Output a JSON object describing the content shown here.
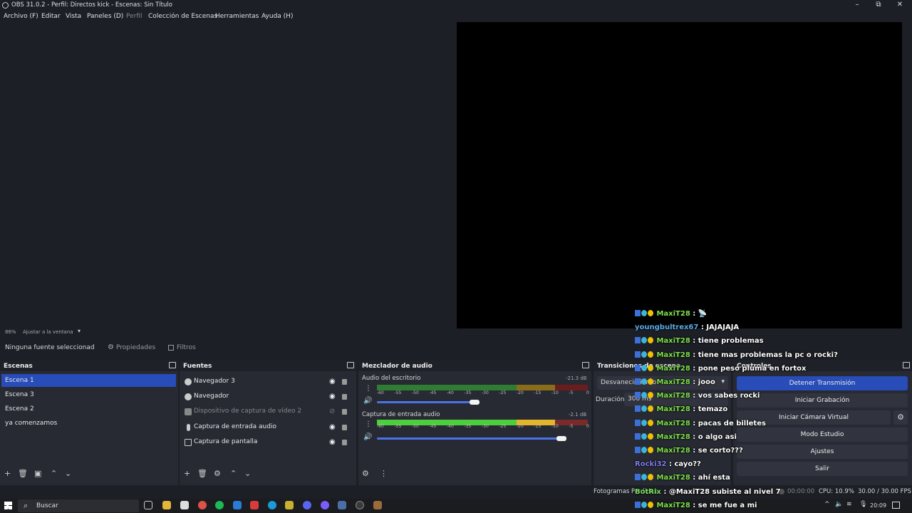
{
  "window": {
    "title": "OBS 31.0.2 - Perfil: Directos kick - Escenas: Sin Título"
  },
  "window_buttons": {
    "minimize": "–",
    "maximize": "⧉",
    "close": "✕"
  },
  "menu": [
    "Archivo (F)",
    "Editar",
    "Vista",
    "Paneles (D)",
    "Perfil",
    "Colección de Escenas",
    "Herramientas",
    "Ayuda (H)"
  ],
  "preview": {
    "zoom": "86%",
    "fit_label": "Ajustar a la ventana"
  },
  "source_toolbar": {
    "no_source": "Ninguna fuente seleccionad",
    "properties": "Propiedades",
    "filters": "Filtros"
  },
  "scenes": {
    "title": "Escenas",
    "items": [
      "Escena 1",
      "Escena 3",
      "Escena 2",
      "ya comenzamos"
    ],
    "selected": 0
  },
  "sources": {
    "title": "Fuentes",
    "items": [
      {
        "name": "Navegador 3",
        "hidden": false
      },
      {
        "name": "Navegador",
        "hidden": false
      },
      {
        "name": "Dispositivo de captura de vídeo 2",
        "hidden": true
      },
      {
        "name": "Captura de entrada audio",
        "hidden": false
      },
      {
        "name": "Captura de pantalla",
        "hidden": false
      }
    ]
  },
  "mixer": {
    "title": "Mezclador de audio",
    "channels": [
      {
        "name": "Audio del escritorio",
        "db": "-21.3 dB",
        "volume": 0.8
      },
      {
        "name": "Captura de entrada audio",
        "db": "-2.1 dB",
        "volume": 0.97
      }
    ],
    "ticks": [
      "-60",
      "-55",
      "-50",
      "-45",
      "-40",
      "-35",
      "-30",
      "-25",
      "-20",
      "-15",
      "-10",
      "-5",
      "0"
    ]
  },
  "transitions": {
    "title": "Transiciones de escena",
    "type": "Desvanecimiento",
    "duration_label": "Duración",
    "duration": "300 ms"
  },
  "controls": {
    "title": "Controles",
    "buttons": [
      "Detener Transmisión",
      "Iniciar Grabación",
      "Iniciar Cámara Virtual",
      "Modo Estudio",
      "Ajustes",
      "Salir"
    ]
  },
  "status": {
    "dropped": "Fotogramas Perdidos",
    "time": "00:00:00",
    "cpu": "CPU: 10.9%",
    "fps": "30.00 / 30.00 FPS"
  },
  "taskbar": {
    "search": "Buscar",
    "clock": "20:09"
  },
  "chat": [
    {
      "user": "MaxiT28",
      "text": ": 📡",
      "badges": true,
      "color": "green"
    },
    {
      "user": "youngbultrex67",
      "text": ": JAJAJAJA",
      "badges": false,
      "color": "blue"
    },
    {
      "user": "MaxiT28",
      "text": ": tiene problemas",
      "badges": true,
      "color": "green"
    },
    {
      "user": "MaxiT28",
      "text": ": tiene mas problemas la pc o rocki?",
      "badges": true,
      "color": "green"
    },
    {
      "user": "MaxiT28",
      "text": ": pone peso pluma en fortox",
      "badges": true,
      "color": "green"
    },
    {
      "user": "MaxiT28",
      "text": ": jooo",
      "badges": true,
      "color": "green"
    },
    {
      "user": "MaxiT28",
      "text": ": vos sabes rocki",
      "badges": true,
      "color": "green"
    },
    {
      "user": "MaxiT28",
      "text": ": temazo",
      "badges": true,
      "color": "green"
    },
    {
      "user": "MaxiT28",
      "text": ": pacas de billetes",
      "badges": true,
      "color": "green"
    },
    {
      "user": "MaxiT28",
      "text": ": o algo asi",
      "badges": true,
      "color": "green"
    },
    {
      "user": "MaxiT28",
      "text": ": se corto???",
      "badges": true,
      "color": "green"
    },
    {
      "user": "Rocki32",
      "text": ": cayo??",
      "badges": false,
      "color": "purple"
    },
    {
      "user": "MaxiT28",
      "text": ": ahí esta",
      "badges": true,
      "color": "green"
    },
    {
      "user": "BotRix",
      "text": ": @MaxiT28 subiste al nivel 7",
      "badges": false,
      "color": "bot"
    },
    {
      "user": "MaxiT28",
      "text": ": se me fue a mi",
      "badges": true,
      "color": "green"
    }
  ]
}
